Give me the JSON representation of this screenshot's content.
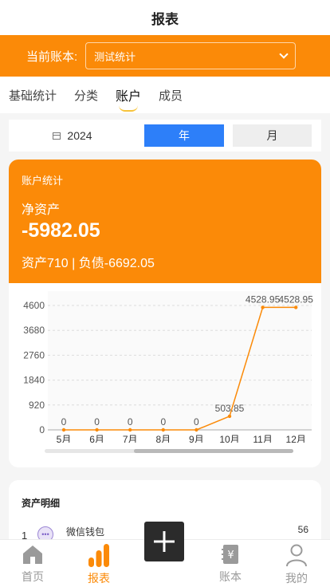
{
  "page": {
    "title": "报表"
  },
  "book": {
    "label": "当前账本:",
    "selected": "测试统计"
  },
  "tabs": [
    {
      "label": "基础统计",
      "active": false
    },
    {
      "label": "分类",
      "active": false
    },
    {
      "label": "账户",
      "active": true
    },
    {
      "label": "成员",
      "active": false
    }
  ],
  "date": {
    "year": "2024",
    "year_btn": "年",
    "month_btn": "月",
    "active": "年"
  },
  "account": {
    "title": "账户统计",
    "net_label": "净资产",
    "net_value": "-5982.05",
    "summary": "资产710 | 负债-6692.05"
  },
  "chart_data": {
    "type": "line",
    "categories": [
      "5月",
      "6月",
      "7月",
      "8月",
      "9月",
      "10月",
      "11月",
      "12月"
    ],
    "values": [
      0,
      0,
      0,
      0,
      0,
      503.85,
      4528.95,
      4528.95
    ],
    "data_labels": [
      "0",
      "0",
      "0",
      "0",
      "0",
      "503.85",
      "4528.95",
      "4528.95"
    ],
    "y_ticks": [
      "0",
      "920",
      "1840",
      "2760",
      "3680",
      "4600"
    ],
    "ylim": [
      0,
      4600
    ],
    "grid": true,
    "colors": {
      "line": "#fb8a08"
    }
  },
  "detail": {
    "title": "资产明细",
    "rows": [
      {
        "index": "1",
        "name": "微信钱包",
        "amount": "56"
      }
    ]
  },
  "tabbar": [
    {
      "label": "首页",
      "icon": "home-icon",
      "active": false
    },
    {
      "label": "报表",
      "icon": "bar-chart-icon",
      "active": true
    },
    {
      "label": "账本",
      "icon": "ledger-icon",
      "active": false
    },
    {
      "label": "我的",
      "icon": "user-icon",
      "active": false
    }
  ],
  "colors": {
    "accent": "#fb8a08",
    "primary": "#2d7ff9"
  }
}
